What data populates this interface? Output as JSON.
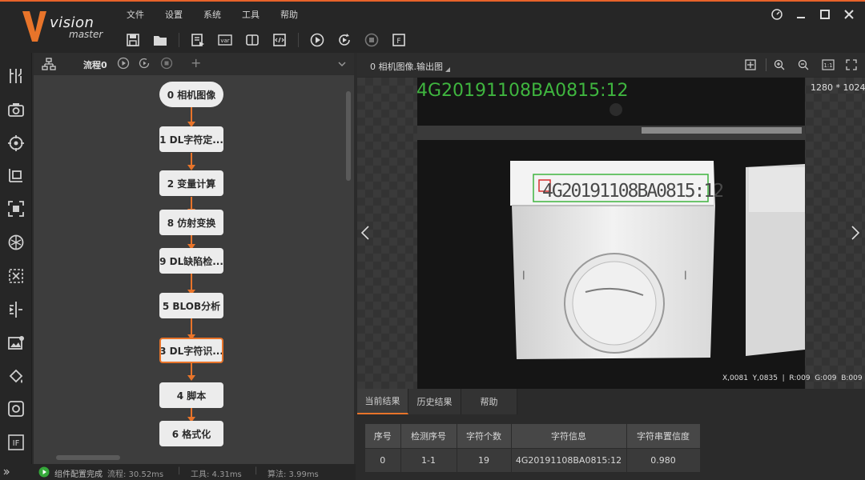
{
  "app": {
    "logo_main": "vision",
    "logo_sub": "master"
  },
  "menu": [
    "文件",
    "设置",
    "系统",
    "工具",
    "帮助"
  ],
  "toolbar": [
    "save-icon",
    "open-folder-icon",
    "run-list-icon",
    "variable-icon",
    "panel-icon",
    "script-icon",
    "run-once-icon",
    "run-loop-icon",
    "stop-icon",
    "format-icon"
  ],
  "flow": {
    "tab": "流程0",
    "nodes": [
      "0 相机图像",
      "1 DL字符定...",
      "2 变量计算",
      "8 仿射变换",
      "9 DL缺陷检...",
      "5 BLOB分析",
      "3 DL字符识...",
      "4 脚本",
      "6 格式化"
    ],
    "selected_index": 6
  },
  "image_view": {
    "title": "0 相机图像.输出图",
    "resolution": "1280 * 1024",
    "ocr_overlay": "4G20191108BA0815:12",
    "coords": "X,0081  Y,0835  |  R:009  G:009  B:009",
    "package_text": "4G20191108BA0815:12"
  },
  "results": {
    "tabs": [
      "当前结果",
      "历史结果",
      "帮助"
    ],
    "active_tab": 0,
    "columns": [
      "序号",
      "检测序号",
      "字符个数",
      "字符信息",
      "字符串置信度"
    ],
    "rows": [
      [
        "0",
        "1-1",
        "19",
        "4G20191108BA0815:12",
        "0.980"
      ]
    ]
  },
  "status": {
    "message": "组件配置完成",
    "flow_label": "流程: 30.52ms",
    "tool_label": "工具: 4.31ms",
    "algo_label": "算法: 3.99ms"
  },
  "colors": {
    "accent": "#e8742a",
    "ocr_green": "#3fb53f"
  }
}
